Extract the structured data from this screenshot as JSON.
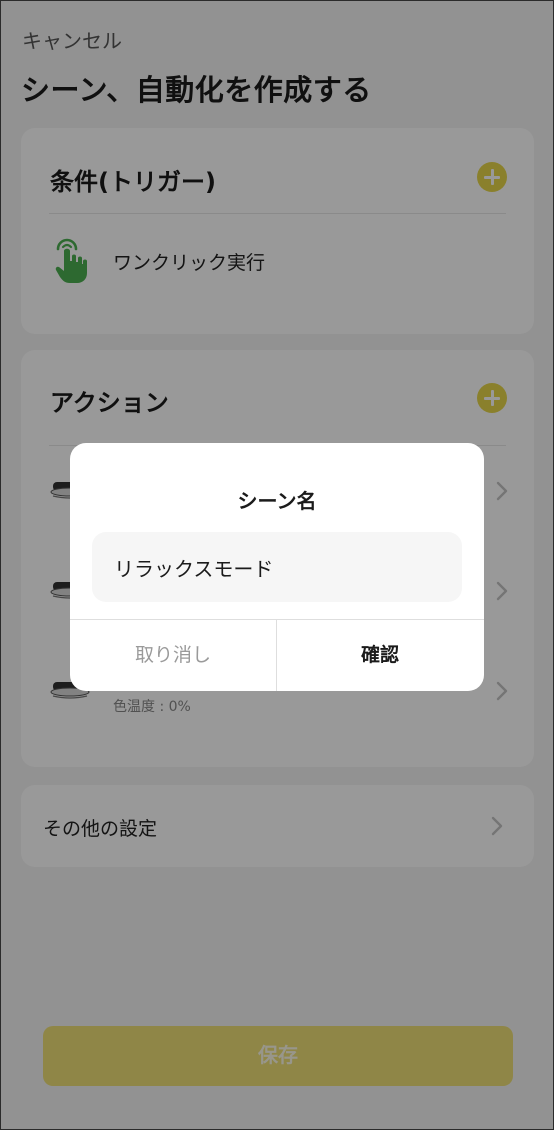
{
  "header": {
    "cancel_label": "キャンセル",
    "title": "シーン、自動化を作成する"
  },
  "conditions": {
    "heading": "条件(トリガー)",
    "add_icon": "plus-circle-icon",
    "items": [
      {
        "icon": "tap-hand-icon",
        "label": "ワンクリック実行"
      }
    ]
  },
  "actions": {
    "heading": "アクション",
    "add_icon": "plus-circle-icon",
    "items": [
      {
        "icon": "ceiling-light-icon",
        "label": "",
        "detail": ""
      },
      {
        "icon": "ceiling-light-icon",
        "label": "",
        "detail": ""
      },
      {
        "icon": "ceiling-light-icon",
        "label": "",
        "detail": "色温度 : 0%"
      }
    ]
  },
  "other_settings": {
    "label": "その他の設定"
  },
  "save": {
    "label": "保存"
  },
  "dialog": {
    "title": "シーン名",
    "input_value": "リラックスモード",
    "cancel_label": "取り消し",
    "confirm_label": "確認"
  },
  "colors": {
    "accent": "#e6d64a",
    "icon_green": "#4caf50",
    "overlay": "rgba(0,0,0,0.4)"
  }
}
